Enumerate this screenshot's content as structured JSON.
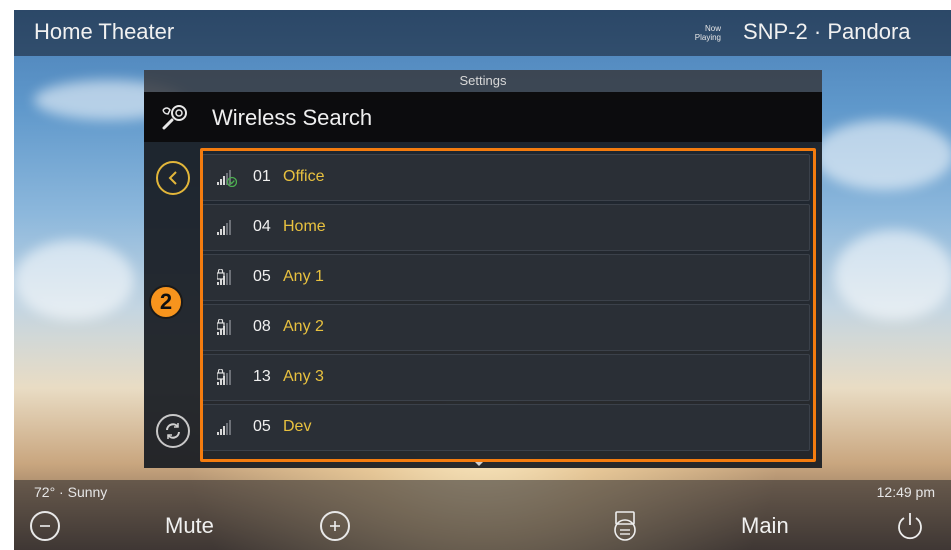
{
  "header": {
    "title": "Home Theater",
    "now_playing": "Now Playing",
    "source": "SNP-2 · Pandora"
  },
  "panel": {
    "section_label": "Settings",
    "title": "Wireless Search"
  },
  "networks": [
    {
      "number": "01",
      "name": "Office",
      "locked": false,
      "connected": true
    },
    {
      "number": "04",
      "name": "Home",
      "locked": false,
      "connected": false
    },
    {
      "number": "05",
      "name": "Any 1",
      "locked": true,
      "connected": false
    },
    {
      "number": "08",
      "name": "Any 2",
      "locked": true,
      "connected": false
    },
    {
      "number": "13",
      "name": "Any 3",
      "locked": true,
      "connected": false
    },
    {
      "number": "05",
      "name": "Dev",
      "locked": false,
      "connected": false
    }
  ],
  "callout": {
    "number": "2"
  },
  "footer": {
    "weather": "72° · Sunny",
    "time": "12:49 pm",
    "mute_label": "Mute",
    "main_label": "Main"
  },
  "colors": {
    "accent": "#e8c13f",
    "highlight": "#f47c0f",
    "callout": "#f7941d",
    "connected": "#4caf50"
  },
  "icons": [
    "tools-gear-icon",
    "back-chevron-icon",
    "refresh-icon",
    "signal-icon",
    "lock-icon",
    "volume-down-icon",
    "volume-up-icon",
    "display-menu-icon",
    "power-icon"
  ]
}
